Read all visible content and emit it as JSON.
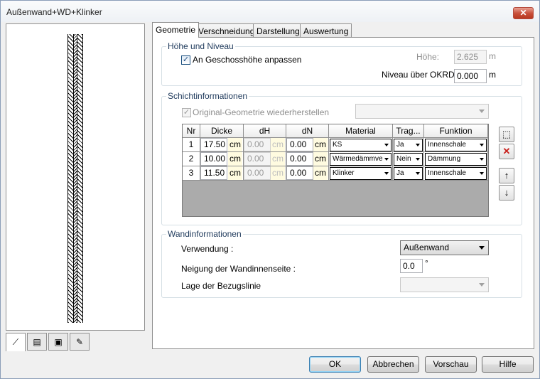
{
  "window": {
    "title": "Außenwand+WD+Klinker",
    "close_label": "✕"
  },
  "tabs": [
    {
      "label": "Geometrie"
    },
    {
      "label": "Verschneidung"
    },
    {
      "label": "Darstellung"
    },
    {
      "label": "Auswertung"
    }
  ],
  "left_tabs": [
    {
      "icon": "wall-geometry-icon",
      "glyph": "⟋"
    },
    {
      "icon": "layers-icon",
      "glyph": "▤"
    },
    {
      "icon": "image-icon",
      "glyph": "▣"
    },
    {
      "icon": "note-icon",
      "glyph": "✎"
    }
  ],
  "hoehe": {
    "title": "Höhe und Niveau",
    "checkbox_label": "An Geschosshöhe anpassen",
    "checkbox_checked": true,
    "hoehe_label": "Höhe:",
    "hoehe_value": "2.625",
    "hoehe_unit": "m",
    "niveau_label": "Niveau über OKRD:",
    "niveau_value": "0.000",
    "niveau_unit": "m"
  },
  "schicht": {
    "title": "Schichtinformationen",
    "restore_label": "Original-Geometrie wiederherstellen",
    "restore_checked": true,
    "preset_value": "",
    "columns": [
      "Nr",
      "Dicke",
      "dH",
      "dN",
      "Material",
      "Trag...",
      "Funktion"
    ],
    "rows": [
      {
        "nr": "1",
        "dicke": "17.50",
        "dicke_unit": "cm",
        "dh": "0.00",
        "dh_unit": "cm",
        "dn": "0.00",
        "dn_unit": "cm",
        "material": "KS",
        "trag": "Ja",
        "funktion": "Innenschale"
      },
      {
        "nr": "2",
        "dicke": "10.00",
        "dicke_unit": "cm",
        "dh": "0.00",
        "dh_unit": "cm",
        "dn": "0.00",
        "dn_unit": "cm",
        "material": "Wärmedämmve",
        "trag": "Nein",
        "funktion": "Dämmung"
      },
      {
        "nr": "3",
        "dicke": "11.50",
        "dicke_unit": "cm",
        "dh": "0.00",
        "dh_unit": "cm",
        "dn": "0.00",
        "dn_unit": "cm",
        "material": "Klinker",
        "trag": "Ja",
        "funktion": "Innenschale"
      }
    ],
    "side_buttons": [
      {
        "icon": "new-layer-icon",
        "glyph": "⬚"
      },
      {
        "icon": "delete-icon",
        "glyph": "✕"
      },
      {
        "icon": "move-up-icon",
        "glyph": "↑"
      },
      {
        "icon": "move-down-icon",
        "glyph": "↓"
      }
    ]
  },
  "wand": {
    "title": "Wandinformationen",
    "verwendung_label": "Verwendung :",
    "verwendung_value": "Außenwand",
    "neigung_label": "Neigung der Wandinnenseite :",
    "neigung_value": "0.0",
    "neigung_unit": "°",
    "lage_label": "Lage der Bezugslinie",
    "lage_value": ""
  },
  "buttons": {
    "ok": "OK",
    "cancel": "Abbrechen",
    "preview": "Vorschau",
    "help": "Hilfe"
  },
  "colors": {
    "delete": "#c8201c",
    "group_title": "#1e395b",
    "unit_bg": "#fffbe0"
  }
}
